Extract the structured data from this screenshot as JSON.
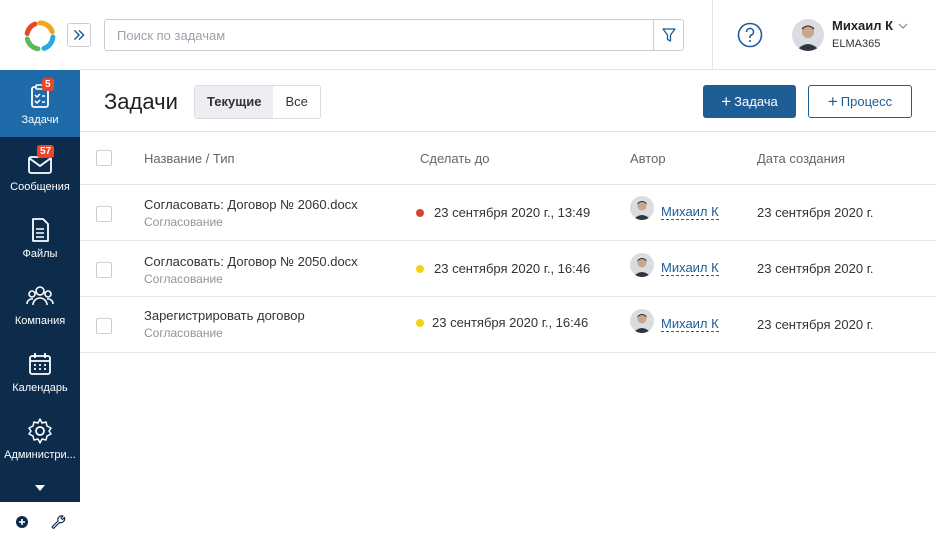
{
  "sidebar": {
    "items": [
      {
        "label": "Задачи",
        "badge": "5"
      },
      {
        "label": "Сообщения",
        "badge": "57"
      },
      {
        "label": "Файлы"
      },
      {
        "label": "Компания"
      },
      {
        "label": "Календарь"
      },
      {
        "label": "Администри..."
      }
    ]
  },
  "header": {
    "search_placeholder": "Поиск по задачам",
    "user_name": "Михаил К",
    "user_org": "ELMA365"
  },
  "page": {
    "title": "Задачи",
    "tab_current": "Текущие",
    "tab_all": "Все",
    "new_task_label": "Задача",
    "new_process_label": "Процесс"
  },
  "table": {
    "headers": [
      "Название / Тип",
      "Сделать до",
      "Автор",
      "Дата создания"
    ],
    "rows": [
      {
        "name": "Согласовать: Договор № 2060.docx",
        "type": "Согласование",
        "due": "23 сентября 2020 г., 13:49",
        "author": "Михаил К",
        "created": "23 сентября 2020 г."
      },
      {
        "name": "Согласовать: Договор № 2050.docx",
        "type": "Согласование",
        "due": "23 сентября 2020 г., 16:46",
        "author": "Михаил К",
        "created": "23 сентября 2020 г."
      },
      {
        "name": "Зарегистрировать договор",
        "type": "Согласование",
        "due": "23 сентября 2020 г., 16:46",
        "author": "Михаил К",
        "created": "23 сентября 2020 г."
      }
    ]
  },
  "colors": {
    "sidebar_bg": "#0d2c4c",
    "sidebar_active": "#1f6aa8",
    "accent": "#1f5d97",
    "due_red": "#d4472c",
    "due_yellow": "#f5d313"
  },
  "icons": [
    "elma-logo-icon",
    "double-chevron-right-icon",
    "filter-icon",
    "help-icon",
    "chevron-down-icon",
    "tasks-icon",
    "messages-icon",
    "files-icon",
    "company-icon",
    "calendar-icon",
    "settings-icon",
    "more-down-icon",
    "add-circle-icon",
    "wrench-icon"
  ]
}
